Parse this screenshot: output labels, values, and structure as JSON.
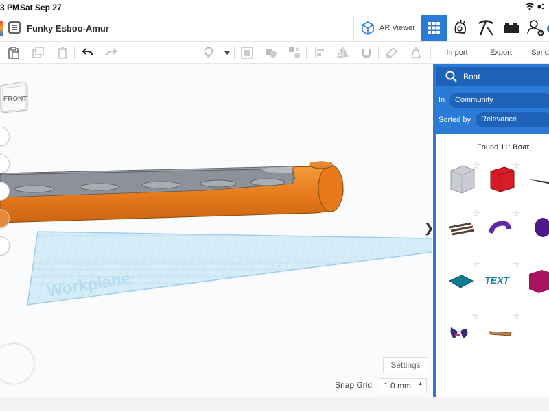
{
  "status_bar": {
    "time": "3 PM",
    "date": "Sat Sep 27"
  },
  "title_bar": {
    "design_title": "Funky Esboo-Amur",
    "ar_viewer_label": "AR Viewer"
  },
  "toolbar": {
    "import_label": "Import",
    "export_label": "Export",
    "send_label": "Send"
  },
  "workspace": {
    "viewcube_label": "FRONT",
    "workplane_label": "Workplane",
    "settings_label": "Settings",
    "snap_grid_label": "Snap Grid",
    "snap_grid_value": "1.0 mm"
  },
  "panel": {
    "search_value": "Boat",
    "in_label": "In",
    "in_value": "Community",
    "sorted_label": "Sorted by",
    "sorted_value": "Relevance",
    "found_prefix": "Found 11: ",
    "found_term": "Boat",
    "shapes": [
      "gray-box",
      "red-box",
      "dark-sliver",
      "wooden-raft",
      "purple-pipe",
      "purple-blob",
      "teal-boat",
      "teal-text",
      "magenta-box",
      "purple-figure",
      "orange-boat"
    ]
  },
  "colors": {
    "accent_blue": "#2b7ad6",
    "hull_orange": "#e87a1d",
    "hull_gray": "#8d9199",
    "workplane": "#c8e6f5"
  }
}
